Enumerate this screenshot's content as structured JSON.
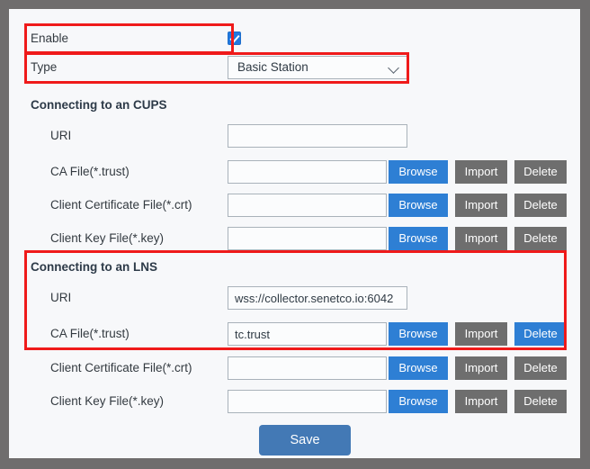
{
  "form": {
    "enable": {
      "label": "Enable",
      "checked": true
    },
    "type": {
      "label": "Type",
      "value": "Basic Station",
      "options": [
        "Basic Station"
      ]
    },
    "buttons": {
      "browse": "Browse",
      "import": "Import",
      "delete": "Delete"
    },
    "save_label": "Save",
    "sections": [
      {
        "title": "Connecting to an CUPS",
        "rows": [
          {
            "label": "URI",
            "value": "",
            "kind": "uri"
          },
          {
            "label": "CA File(*.trust)",
            "value": "",
            "kind": "file",
            "delete_active": false
          },
          {
            "label": "Client Certificate File(*.crt)",
            "value": "",
            "kind": "file",
            "delete_active": false
          },
          {
            "label": "Client Key File(*.key)",
            "value": "",
            "kind": "file",
            "delete_active": false
          }
        ]
      },
      {
        "title": "Connecting to an LNS",
        "rows": [
          {
            "label": "URI",
            "value": "wss://collector.senetco.io:6042",
            "kind": "uri"
          },
          {
            "label": "CA File(*.trust)",
            "value": "tc.trust",
            "kind": "file",
            "delete_active": true
          },
          {
            "label": "Client Certificate File(*.crt)",
            "value": "",
            "kind": "file",
            "delete_active": false
          },
          {
            "label": "Client Key File(*.key)",
            "value": "",
            "kind": "file",
            "delete_active": false
          }
        ]
      }
    ]
  },
  "colors": {
    "accent_blue": "#2e7fd4",
    "gray_button": "#6e6e6e",
    "save_blue": "#4379b5",
    "highlight_red": "#ef1a1a",
    "frame_gray": "#6f6d6d",
    "page_bg": "#f7f8fa"
  }
}
